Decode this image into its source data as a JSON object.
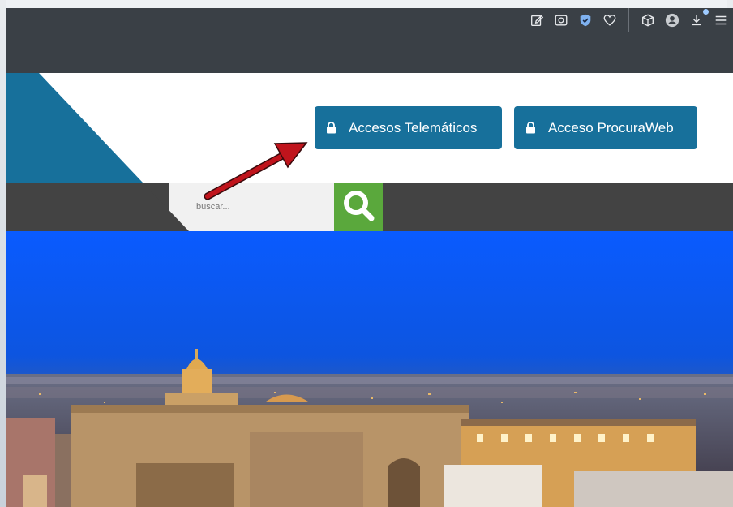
{
  "browser": {
    "toolbar_icons": [
      "edit-page-icon",
      "screenshot-camera-icon",
      "shield-check-icon",
      "heart-icon",
      "cube-icon",
      "profile-avatar-icon",
      "download-icon",
      "menu-icon"
    ]
  },
  "header": {
    "buttons": [
      {
        "label": "Accesos Telemáticos",
        "icon": "lock-icon"
      },
      {
        "label": "Acceso ProcuraWeb",
        "icon": "lock-icon"
      }
    ]
  },
  "search": {
    "placeholder": "buscar...",
    "icon": "search-icon"
  },
  "colors": {
    "toolbar": "#3a4046",
    "brand_blue": "#17709b",
    "search_green": "#5aa83c",
    "dark_bar": "#434343",
    "arrow_red": "#c0141c"
  }
}
